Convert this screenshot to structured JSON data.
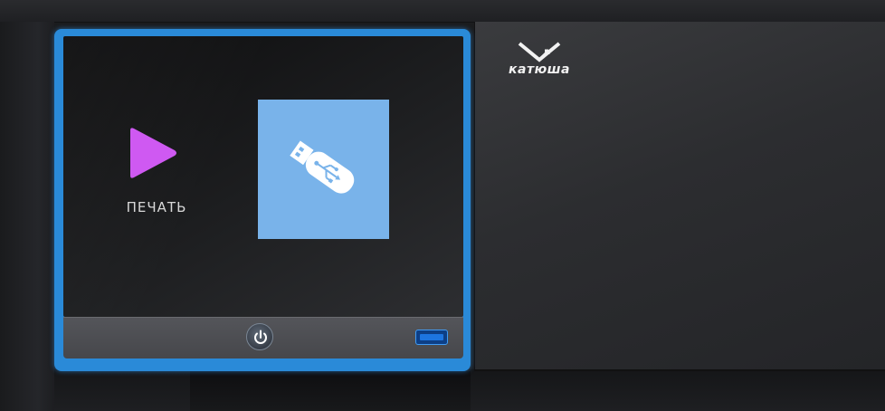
{
  "brand": {
    "logo_text": "катюша",
    "logo_icon": "katusha-logo-icon"
  },
  "screen": {
    "tiles": [
      {
        "label": "ПЕЧАТЬ",
        "icon": "play-icon",
        "icon_color": "#cf59f2"
      },
      {
        "label": "",
        "icon": "usb-drive-icon",
        "tile_color": "#79b3ea"
      }
    ]
  },
  "controls": {
    "power_icon": "power-icon",
    "usb_port_icon": "usb-port-icon"
  },
  "colors": {
    "frame_accent": "#2a8ad8",
    "body": "#1b1c1e",
    "panel": "#2f3033"
  }
}
